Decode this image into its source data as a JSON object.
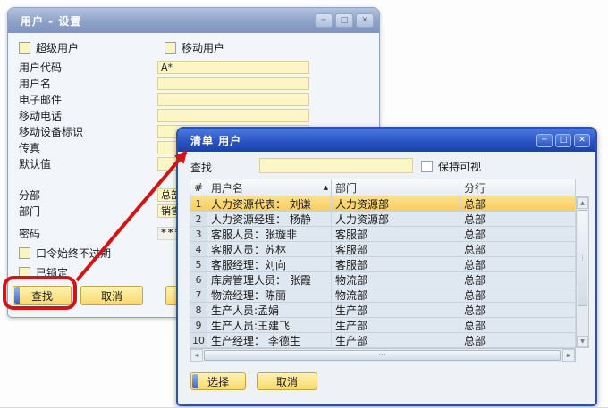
{
  "window_user_settings": {
    "title": "用户 - 设置",
    "super_user_checkbox": "超级用户",
    "mobile_user_checkbox": "移动用户",
    "fields": [
      {
        "label": "用户代码",
        "value": "A*"
      },
      {
        "label": "用户名",
        "value": ""
      },
      {
        "label": "电子邮件",
        "value": ""
      },
      {
        "label": "移动电话",
        "value": ""
      },
      {
        "label": "移动设备标识",
        "value": ""
      },
      {
        "label": "传真",
        "value": ""
      },
      {
        "label": "默认值",
        "value": ""
      }
    ],
    "branch_label": "分部",
    "branch_value": "总部",
    "department_label": "部门",
    "department_value": "销售",
    "password_label": "密码",
    "password_value": "*****",
    "password_never_expires_checkbox": "口令始终不过期",
    "locked_checkbox": "已锁定",
    "find_button": "查找",
    "cancel_button": "取消"
  },
  "window_user_list": {
    "title": "清单 用户",
    "find_label": "查找",
    "find_value": "",
    "keep_visible_checkbox": "保持可视",
    "table": {
      "headers": [
        "#",
        "用户名",
        "部门",
        "分行"
      ],
      "sorted_column": "用户名",
      "rows": [
        [
          "1",
          "人力资源代表： 刘谦",
          "人力资源部",
          "总部"
        ],
        [
          "2",
          "人力资源经理： 杨静",
          "人力资源部",
          "总部"
        ],
        [
          "3",
          "客服人员：张璇非",
          "客服部",
          "总部"
        ],
        [
          "4",
          "客服人员：苏林",
          "客服部",
          "总部"
        ],
        [
          "5",
          "客服经理：刘向",
          "客服部",
          "总部"
        ],
        [
          "6",
          "库房管理人员： 张霞",
          "物流部",
          "总部"
        ],
        [
          "7",
          "物流经理：陈丽",
          "物流部",
          "总部"
        ],
        [
          "8",
          "生产人员:孟娟",
          "生产部",
          "总部"
        ],
        [
          "9",
          "生产人员:王建飞",
          "生产部",
          "总部"
        ],
        [
          "10",
          "生产经理： 李德生",
          "生产部",
          "总部"
        ]
      ],
      "selected_row_index": 0
    },
    "choose_button": "选择",
    "cancel_button": "取消"
  },
  "icons": {
    "minimize": "─",
    "maximize": "□",
    "close": "✕",
    "sort_ascending": "▲",
    "scroll_up": "▲",
    "scroll_down": "▼",
    "scroll_left": "◄",
    "scroll_right": "►",
    "h_grip": "⋯",
    "v_grip": "⋮"
  },
  "colors": {
    "active_titlebar": "#2a54c4",
    "inactive_titlebar": "#8ea2c8",
    "field_yellow": "#fcf5c5",
    "selected_row_yellow": "#f9cd60",
    "button_yellow": "#f8da6e",
    "annotation_red": "#d21414"
  }
}
